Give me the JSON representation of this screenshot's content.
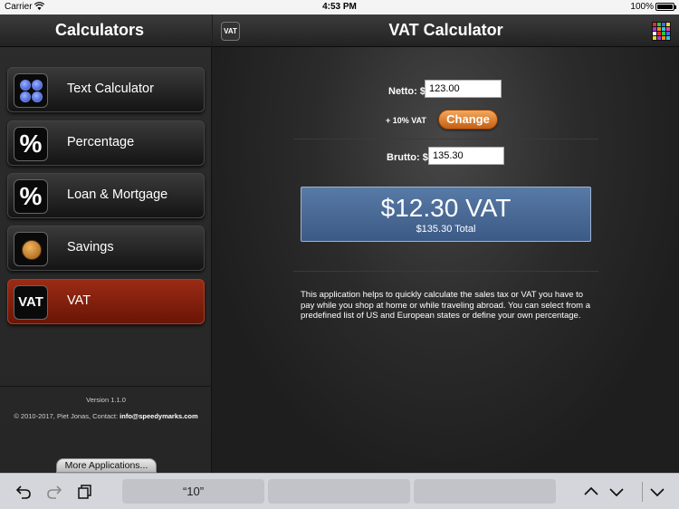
{
  "status_bar": {
    "carrier": "Carrier",
    "time": "4:53 PM",
    "battery": "100%"
  },
  "sidebar": {
    "title": "Calculators",
    "items": [
      {
        "label": "Text Calculator",
        "icon": "dots-icon"
      },
      {
        "label": "Percentage",
        "icon": "percent-icon",
        "icon_text": "%"
      },
      {
        "label": "Loan & Mortgage",
        "icon": "percent-icon",
        "icon_text": "%"
      },
      {
        "label": "Savings",
        "icon": "coin-icon"
      },
      {
        "label": "VAT",
        "icon": "vat-icon",
        "icon_text": "VAT",
        "active": true
      }
    ],
    "version": "Version 1.1.0",
    "copyright": "© 2010-2017, Piet Jonas, Contact:",
    "email": "info@speedymarks.com",
    "more_apps": "More Applications..."
  },
  "main": {
    "title": "VAT Calculator",
    "badge": "VAT",
    "netto_label": "Netto: $",
    "netto_value": "123.00",
    "vat_label": "+ 10% VAT",
    "change_button": "Change",
    "brutto_label": "Brutto: $",
    "brutto_value": "135.30",
    "result_vat": "$12.30 VAT",
    "result_total": "$135.30 Total",
    "description": "This application helps to quickly calculate the sales tax or VAT you have to pay while you shop at home or while traveling abroad. You can select from a predefined list of US and European states or define your own percentage.",
    "grid_colors": [
      "#e52b2b",
      "#35c43a",
      "#3b6ce8",
      "#f2d12a",
      "#a936d9",
      "#f28a1e",
      "#2bc9d8",
      "#e83fae",
      "#ffffff",
      "#e52b2b",
      "#35c43a",
      "#3b6ce8",
      "#f2d12a",
      "#a936d9",
      "#f28a1e",
      "#2bc9d8"
    ]
  },
  "toolbar": {
    "suggestion": "“10”"
  },
  "colors": {
    "active_item": "#8a2410",
    "result_panel": "#4a6a98",
    "change_button": "#e07b24"
  }
}
